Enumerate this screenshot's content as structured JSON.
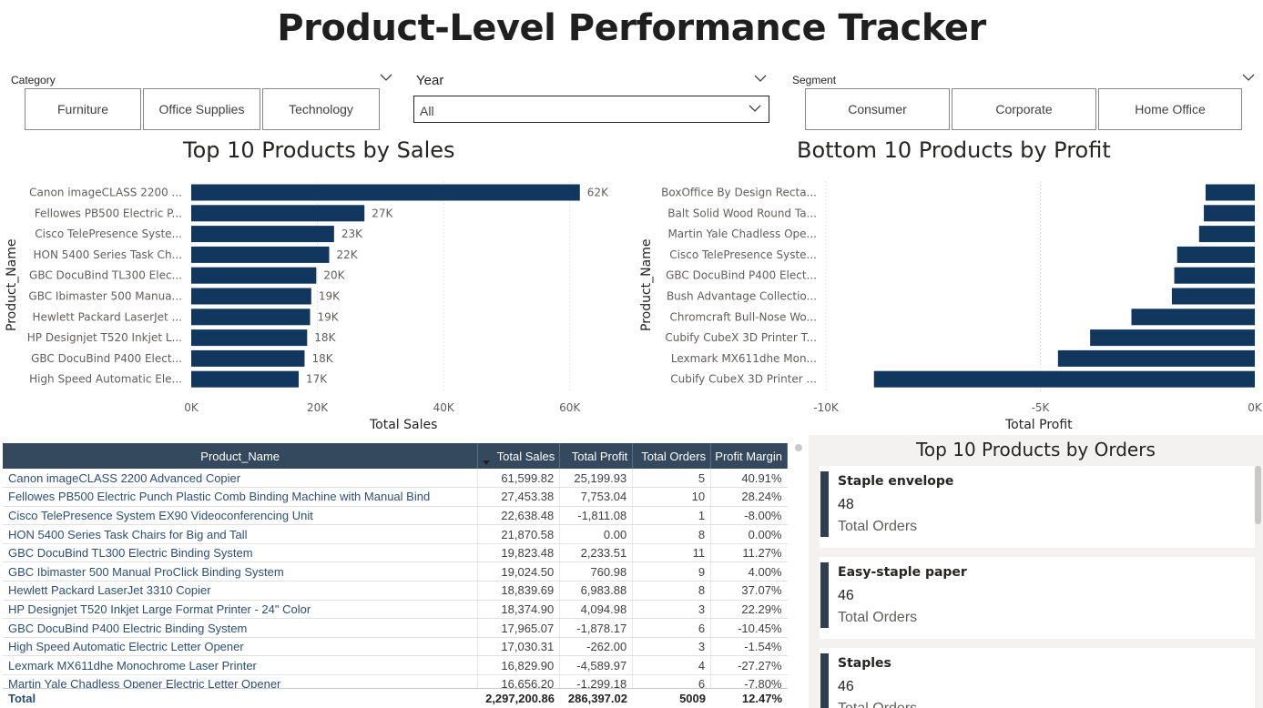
{
  "page_title": "Product-Level Performance Tracker",
  "filters": {
    "category": {
      "label": "Category",
      "options": [
        "Furniture",
        "Office Supplies",
        "Technology"
      ]
    },
    "year": {
      "label": "Year",
      "selected": "All"
    },
    "segment": {
      "label": "Segment",
      "options": [
        "Consumer",
        "Corporate",
        "Home Office"
      ]
    }
  },
  "charts": {
    "top_sales": {
      "title": "Top 10 Products by Sales",
      "xlabel": "Total Sales",
      "ylabel": "Product_Name"
    },
    "bottom_profit": {
      "title": "Bottom 10 Products by Profit",
      "xlabel": "Total Profit",
      "ylabel": "Product_Name"
    }
  },
  "chart_data": [
    {
      "type": "bar",
      "orientation": "horizontal",
      "title": "Top 10 Products by Sales",
      "xlabel": "Total Sales",
      "ylabel": "Product_Name",
      "categories": [
        "Canon imageCLASS 2200 ...",
        "Fellowes PB500 Electric P...",
        "Cisco TelePresence Syste...",
        "HON 5400 Series Task Ch...",
        "GBC DocuBind TL300 Elec...",
        "GBC Ibimaster 500 Manua...",
        "Hewlett Packard LaserJet ...",
        "HP Designjet T520 Inkjet L...",
        "GBC DocuBind P400 Elect...",
        "High Speed Automatic Ele..."
      ],
      "values": [
        61599.82,
        27453.38,
        22638.48,
        21870.58,
        19823.48,
        19024.5,
        18839.69,
        18374.9,
        17965.07,
        17030.31
      ],
      "data_labels": [
        "62K",
        "27K",
        "23K",
        "22K",
        "20K",
        "19K",
        "19K",
        "18K",
        "18K",
        "17K"
      ],
      "xlim": [
        0,
        70000
      ],
      "ticks": [
        0,
        20000,
        40000,
        60000
      ],
      "tick_labels": [
        "0K",
        "20K",
        "40K",
        "60K"
      ],
      "bar_color": "#12375f"
    },
    {
      "type": "bar",
      "orientation": "horizontal",
      "title": "Bottom 10 Products by Profit",
      "xlabel": "Total Profit",
      "ylabel": "Product_Name",
      "categories": [
        "BoxOffice By Design Recta...",
        "Balt Solid Wood Round Ta...",
        "Martin Yale Chadless Ope...",
        "Cisco TelePresence Syste...",
        "GBC DocuBind P400 Elect...",
        "Bush Advantage Collectio...",
        "Chromcraft Bull-Nose Wo...",
        "Cubify CubeX 3D Printer T...",
        "Lexmark MX611dhe Mon...",
        "Cubify CubeX 3D Printer ..."
      ],
      "values": [
        -1148,
        -1188,
        -1299,
        -1811,
        -1878,
        -1934,
        -2877,
        -3840,
        -4590,
        -8880
      ],
      "xlim": [
        -10000,
        0
      ],
      "ticks": [
        -10000,
        -5000,
        0
      ],
      "tick_labels": [
        "-10K",
        "-5K",
        "0K"
      ],
      "bar_color": "#12375f"
    }
  ],
  "table": {
    "columns": [
      "Product_Name",
      "Total Sales",
      "Total Profit",
      "Total Orders",
      "Profit Margin"
    ],
    "rows": [
      [
        "Canon imageCLASS 2200 Advanced Copier",
        "61,599.82",
        "25,199.93",
        "5",
        "40.91%"
      ],
      [
        "Fellowes PB500 Electric Punch Plastic Comb Binding Machine with Manual Bind",
        "27,453.38",
        "7,753.04",
        "10",
        "28.24%"
      ],
      [
        "Cisco TelePresence System EX90 Videoconferencing Unit",
        "22,638.48",
        "-1,811.08",
        "1",
        "-8.00%"
      ],
      [
        "HON 5400 Series Task Chairs for Big and Tall",
        "21,870.58",
        "0.00",
        "8",
        "0.00%"
      ],
      [
        "GBC DocuBind TL300 Electric Binding System",
        "19,823.48",
        "2,233.51",
        "11",
        "11.27%"
      ],
      [
        "GBC Ibimaster 500 Manual ProClick Binding System",
        "19,024.50",
        "760.98",
        "9",
        "4.00%"
      ],
      [
        "Hewlett Packard LaserJet 3310 Copier",
        "18,839.69",
        "6,983.88",
        "8",
        "37.07%"
      ],
      [
        "HP Designjet T520 Inkjet Large Format Printer - 24\" Color",
        "18,374.90",
        "4,094.98",
        "3",
        "22.29%"
      ],
      [
        "GBC DocuBind P400 Electric Binding System",
        "17,965.07",
        "-1,878.17",
        "6",
        "-10.45%"
      ],
      [
        "High Speed Automatic Electric Letter Opener",
        "17,030.31",
        "-262.00",
        "3",
        "-1.54%"
      ],
      [
        "Lexmark MX611dhe Monochrome Laser Printer",
        "16,829.90",
        "-4,589.97",
        "4",
        "-27.27%"
      ],
      [
        "Martin Yale Chadless Opener Electric Letter Opener",
        "16,656.20",
        "-1,299.18",
        "6",
        "-7.80%"
      ]
    ],
    "total": [
      "Total",
      "2,297,200.86",
      "286,397.02",
      "5009",
      "12.47%"
    ]
  },
  "orders_cards": {
    "title": "Top 10 Products by Orders",
    "cards": [
      {
        "name": "Staple envelope",
        "value": "48",
        "label": "Total Orders"
      },
      {
        "name": "Easy-staple paper",
        "value": "46",
        "label": "Total Orders"
      },
      {
        "name": "Staples",
        "value": "46",
        "label": "Total Orders"
      }
    ]
  },
  "colors": {
    "bar": "#12375f",
    "table_header": "#34495e",
    "card_accent": "#2f3e51"
  }
}
